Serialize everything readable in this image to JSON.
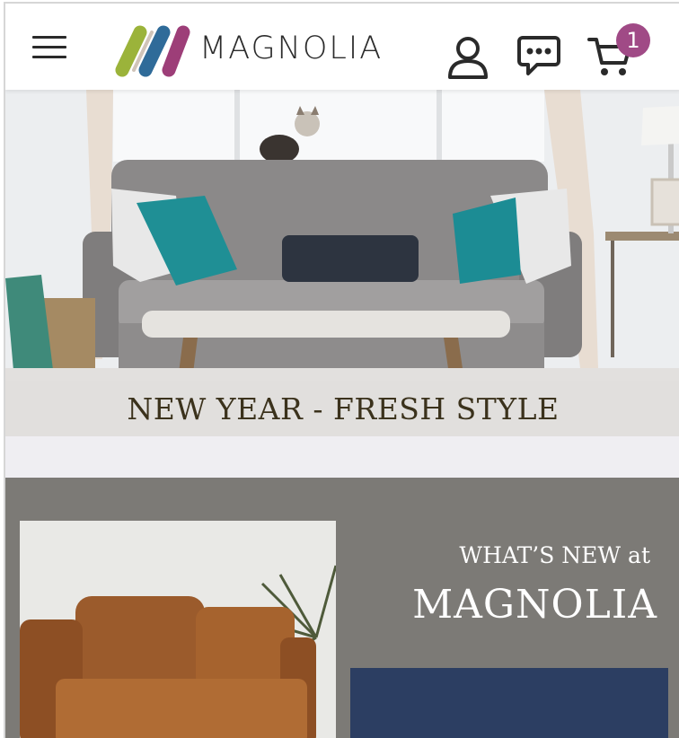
{
  "header": {
    "brand": "MAGNOLIA",
    "menu_icon": "hamburger-menu-icon",
    "account_icon": "user-icon",
    "chat_icon": "chat-icon",
    "cart_icon": "cart-icon",
    "cart_count": "1",
    "logo_colors": [
      "#9bb33a",
      "#2f6b99",
      "#9d3e78"
    ],
    "badge_color": "#a04a86"
  },
  "hero": {
    "caption": "NEW YEAR - FRESH STYLE"
  },
  "promo": {
    "kicker": "WHAT’S NEW at",
    "title": "MAGNOLIA",
    "background": "#7c7a76"
  }
}
